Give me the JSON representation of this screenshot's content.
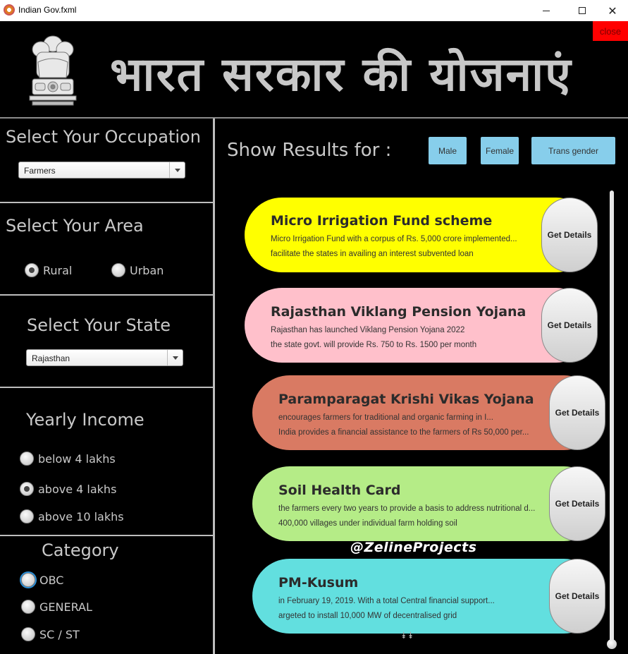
{
  "window": {
    "title": "Indian Gov.fxml"
  },
  "header": {
    "title": "भारत सरकार की योजनाएं",
    "close_label": "close"
  },
  "occupation": {
    "title": "Select Your Occupation",
    "selected": "Farmers"
  },
  "area": {
    "title": "Select Your Area",
    "options": [
      "Rural",
      "Urban"
    ],
    "selected": "Rural"
  },
  "state": {
    "title": "Select Your State",
    "selected": "Rajasthan"
  },
  "income": {
    "title": "Yearly Income",
    "options": [
      "below 4 lakhs",
      "above 4 lakhs",
      "above 10 lakhs"
    ],
    "selected": "above 4 lakhs"
  },
  "category": {
    "title": "Category",
    "options": [
      "OBC",
      "GENERAL",
      "SC / ST"
    ],
    "focused": "OBC"
  },
  "results": {
    "label": "Show Results for :",
    "gender_buttons": [
      "Male",
      "Female",
      "Trans gender"
    ],
    "detail_label": "Get Details",
    "cards": [
      {
        "title": "Micro Irrigation Fund scheme",
        "line1": "Micro Irrigation Fund with a corpus of Rs. 5,000 crore implemented...",
        "line2": " facilitate the states in availing an interest subvented loan",
        "color": "#ffff00"
      },
      {
        "title": "Rajasthan Viklang Pension Yojana",
        "line1": "Rajasthan has launched Viklang Pension Yojana 2022",
        "line2": " the state govt. will provide Rs. 750 to Rs. 1500 per month",
        "color": "#ffc0cb"
      },
      {
        "title": "Paramparagat Krishi Vikas Yojana",
        "line1": "encourages farmers for traditional and organic farming in I...",
        "line2": "India provides a financial assistance to the farmers of Rs 50,000 per...",
        "color": "#d97a63"
      },
      {
        "title": "Soil Health Card",
        "line1": "the farmers every two years to provide a basis to address nutritional d...",
        "line2": "400,000 villages under individual farm holding soil",
        "color": "#b5ec87"
      },
      {
        "title": "PM-Kusum",
        "line1": "in February 19, 2019. With a total Central financial support...",
        "line2": "argeted to install 10,000 MW of decentralised grid",
        "color": "#62dfdf"
      }
    ]
  },
  "watermark": "@ZelineProjects",
  "scroll_arrows": "⯯⯯"
}
